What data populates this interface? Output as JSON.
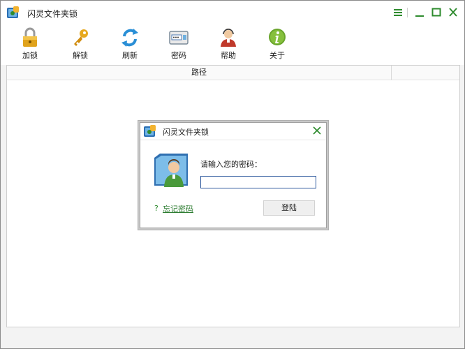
{
  "window": {
    "title": "闪灵文件夹锁"
  },
  "toolbar": {
    "items": [
      {
        "label": "加锁",
        "icon": "padlock-icon"
      },
      {
        "label": "解锁",
        "icon": "key-icon"
      },
      {
        "label": "刷新",
        "icon": "refresh-icon"
      },
      {
        "label": "密码",
        "icon": "password-icon"
      },
      {
        "label": "帮助",
        "icon": "help-agent-icon"
      },
      {
        "label": "关于",
        "icon": "info-icon"
      }
    ]
  },
  "table": {
    "columns": [
      "路径"
    ]
  },
  "dialog": {
    "title": "闪灵文件夹锁",
    "prompt": "请输入您的密码：",
    "password_value": "",
    "forgot_label": "忘记密码",
    "login_label": "登陆"
  },
  "colors": {
    "accent_green": "#2e8b2e",
    "input_border": "#2f5a9e"
  }
}
